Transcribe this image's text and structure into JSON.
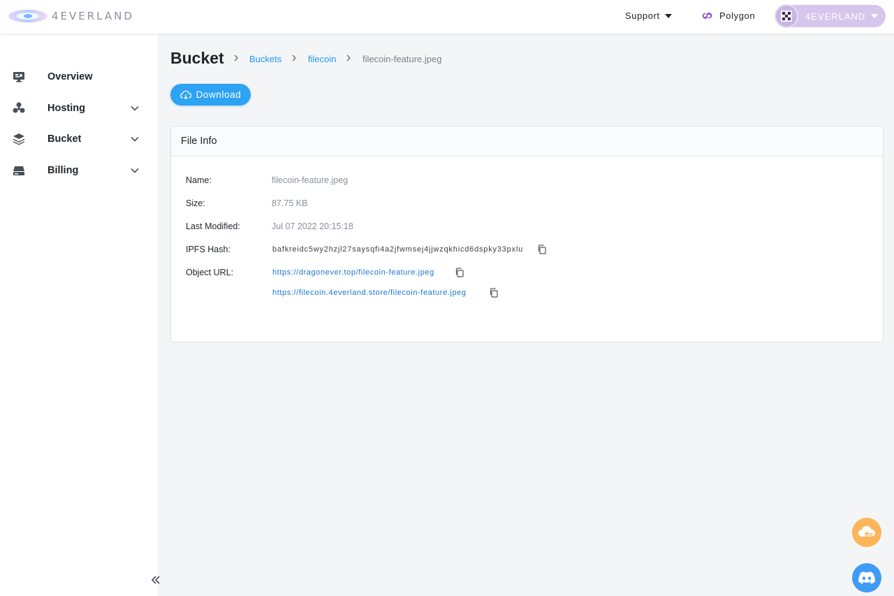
{
  "header": {
    "logo_text": "4EVERLAND",
    "support_label": "Support",
    "network_label": "Polygon",
    "account_label": "4EVERLAND"
  },
  "sidebar": {
    "items": [
      {
        "label": "Overview",
        "icon": "overview-icon"
      },
      {
        "label": "Hosting",
        "icon": "hosting-icon"
      },
      {
        "label": "Bucket",
        "icon": "bucket-icon"
      },
      {
        "label": "Billing",
        "icon": "billing-icon"
      }
    ]
  },
  "main": {
    "title": "Bucket",
    "breadcrumb": [
      "Buckets",
      "filecoin",
      "filecoin-feature.jpeg"
    ],
    "download_label": "Download",
    "file_info": {
      "heading": "File Info",
      "name_label": "Name:",
      "name_value": "filecoin-feature.jpeg",
      "size_label": "Size:",
      "size_value": "87.75 KB",
      "modified_label": "Last Modified:",
      "modified_value": "Jul 07 2022 20:15:18",
      "hash_label": "IPFS Hash:",
      "hash_value": "bafkreidc5wy2hzjl27saysqfi4a2jfwmsej4jjwzqkhicd6dspky33pxlu",
      "url_label": "Object URL:",
      "urls": [
        "https://dragonever.top/filecoin-feature.jpeg",
        "https://filecoin.4everland.store/filecoin-feature.jpeg"
      ]
    }
  },
  "colors": {
    "accent": "#2ea2f3",
    "link": "#2196f3",
    "account_bg": "#d7c6ec",
    "polygon": "#8247e5",
    "upload_fab": "#fbb55b",
    "discord_fab": "#3f9bf5"
  }
}
